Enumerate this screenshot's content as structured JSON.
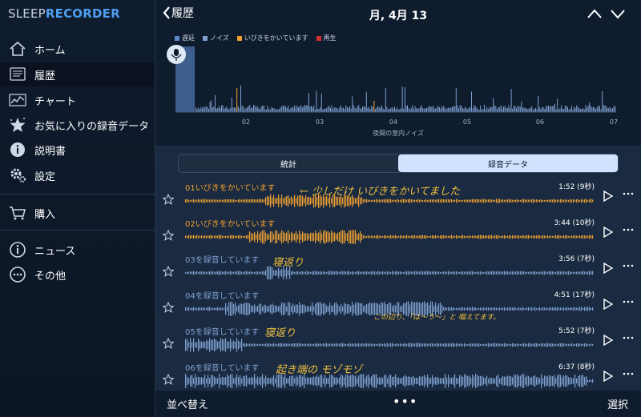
{
  "app": {
    "title_part1": "SLEEP",
    "title_part2": "RECORDER"
  },
  "sidebar": {
    "items": [
      {
        "label": "ホーム",
        "icon": "home-icon"
      },
      {
        "label": "履歴",
        "icon": "history-icon",
        "active": true
      },
      {
        "label": "チャート",
        "icon": "chart-icon"
      },
      {
        "label": "お気に入りの録音データ",
        "icon": "favorites-icon"
      },
      {
        "label": "説明書",
        "icon": "info-icon"
      },
      {
        "label": "設定",
        "icon": "gear-icon"
      },
      {
        "label": "購入",
        "icon": "cart-icon"
      },
      {
        "label": "ニュース",
        "icon": "news-icon"
      },
      {
        "label": "その他",
        "icon": "more-icon"
      }
    ]
  },
  "header": {
    "back_label": "履歴",
    "date": "月, 4月 13"
  },
  "graph": {
    "legend": [
      {
        "label": "遅延",
        "color": "#5b86c8"
      },
      {
        "label": "ノイズ",
        "color": "#7da0d0"
      },
      {
        "label": "いびきをかいています",
        "color": "#f0a030"
      },
      {
        "label": "再生",
        "color": "#d03030"
      }
    ],
    "ticks": [
      "02",
      "03",
      "04",
      "05",
      "06",
      "07"
    ],
    "caption": "夜間の室内ノイズ"
  },
  "tabs": {
    "stats": "統計",
    "recordings": "録音データ",
    "active": "recordings"
  },
  "recordings": [
    {
      "title": "01いびきをかいています",
      "duration": "1:52 (9秒)",
      "color": "#f0a030",
      "annotation": "← 少しだけ いびきをかいてました"
    },
    {
      "title": "02いびきをかいています",
      "duration": "3:44 (10秒)",
      "color": "#f0a030",
      "annotation": ""
    },
    {
      "title": "03を録音しています",
      "duration": "3:56 (7秒)",
      "color": "#7da0d0",
      "annotation": "寝返り"
    },
    {
      "title": "04を録音しています",
      "duration": "4:51 (17秒)",
      "color": "#7da0d0",
      "annotation": "この辺り、「は〜う〜」と 唱えてます。"
    },
    {
      "title": "05を録音しています",
      "duration": "5:52 (7秒)",
      "color": "#7da0d0",
      "annotation": "寝返り"
    },
    {
      "title": "06を録音しています",
      "duration": "6:37 (8秒)",
      "color": "#7da0d0",
      "annotation": "起き端の モゾモゾ"
    }
  ],
  "bottom": {
    "sort_label": "並べ替え",
    "more_label": "•••",
    "select_label": "選択"
  }
}
